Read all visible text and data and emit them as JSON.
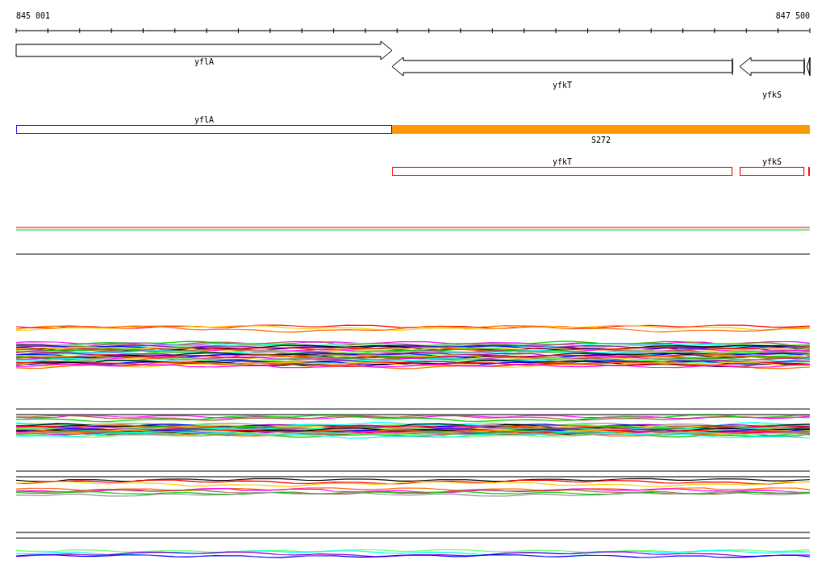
{
  "ruler": {
    "start_label": "845 001",
    "end_label": "847 500"
  },
  "gene_track": [
    {
      "label": "yflA",
      "kind": "forward"
    },
    {
      "label": "yfkT",
      "kind": "reverse"
    },
    {
      "label": "yfkS",
      "kind": "reverse"
    },
    {
      "kind": "reverse"
    }
  ],
  "segment_track": [
    {
      "label": "yflA",
      "kind": "outline",
      "color": "#0000ff"
    },
    {
      "label": "S272",
      "kind": "filled",
      "color": "#ff9900"
    }
  ],
  "region_track": [
    {
      "label": "yfkT",
      "kind": "outline",
      "color": "#ff0000"
    },
    {
      "label": "yfkS",
      "kind": "outline",
      "color": "#ff0000"
    },
    {
      "kind": "filled",
      "color": "#ff0000"
    }
  ]
}
